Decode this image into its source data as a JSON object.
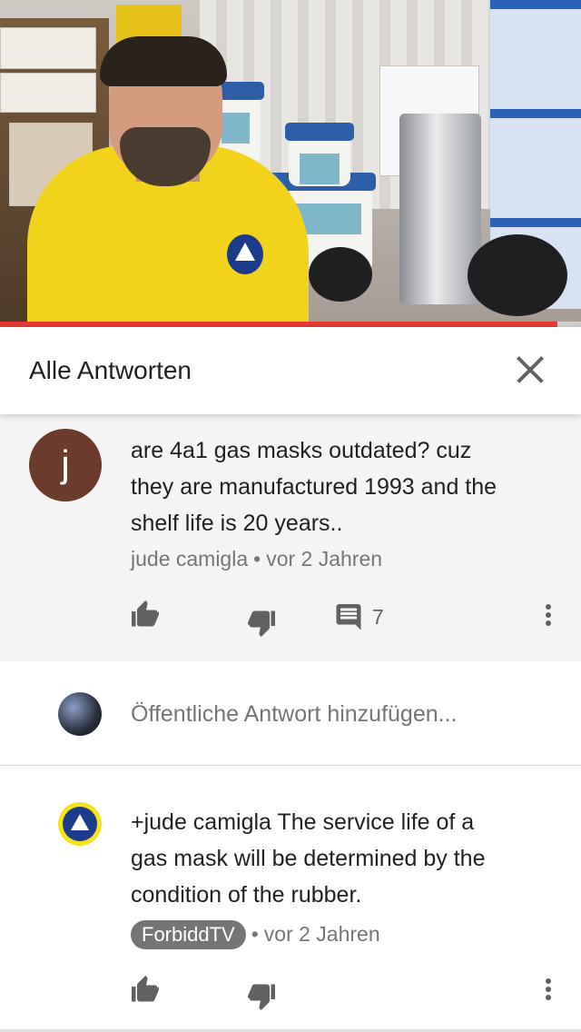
{
  "video": {
    "progress_percent": 96
  },
  "header": {
    "title": "Alle Antworten",
    "close_icon": "close-icon"
  },
  "thread": {
    "avatar_letter": "j",
    "avatar_color": "#6b3b2c",
    "lines": [
      "are 4a1 gas masks outdated? cuz",
      "they are manufactured 1993 and the",
      "shelf life is 20 years.."
    ],
    "author": "jude camigla",
    "time": "vor 2 Jahren",
    "reply_count": "7",
    "icons": [
      "thumb-up-icon",
      "thumb-down-icon",
      "comment-icon",
      "more-vert-icon"
    ]
  },
  "reply_box": {
    "placeholder": "Öffentliche Antwort hinzufügen..."
  },
  "reply": {
    "lines": [
      "+jude camigla The service life of a",
      "gas mask will be determined by the",
      "condition of the rubber."
    ],
    "channel": "ForbiddTV",
    "time": "vor 2 Jahren",
    "icons": [
      "thumb-up-icon",
      "thumb-down-icon",
      "more-vert-icon"
    ]
  },
  "colors": {
    "progress": "#e53935",
    "thread_bg": "#f4f4f4",
    "secondary_text": "#757575"
  }
}
